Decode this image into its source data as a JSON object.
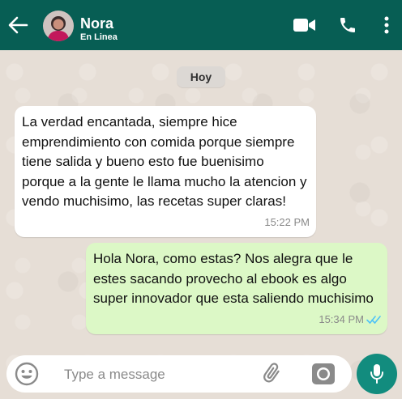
{
  "header": {
    "contact_name": "Nora",
    "status": "En Linea",
    "icons": {
      "back": "arrow-left-icon",
      "video": "video-camera-icon",
      "call": "phone-icon",
      "menu": "more-vert-icon"
    },
    "colors": {
      "bar": "#075e54"
    }
  },
  "chat": {
    "day_label": "Hoy",
    "messages": [
      {
        "direction": "incoming",
        "text": "La verdad encantada, siempre hice emprendimiento con comida porque siempre tiene salida y bueno esto fue buenisimo porque a la gente le llama mucho la atencion y vendo muchisimo, las recetas super claras!",
        "time": "15:22 PM"
      },
      {
        "direction": "outgoing",
        "text": "Hola Nora, como estas? Nos alegra que le estes sacando provecho al ebook es algo super innovador que esta saliendo muchisimo",
        "time": "15:34 PM",
        "status_icon": "double-check-icon"
      }
    ],
    "colors": {
      "incoming": "#ffffff",
      "outgoing": "#dcf8c6",
      "ticks": "#4fc3f7"
    }
  },
  "composer": {
    "placeholder": "Type a message",
    "icons": {
      "emoji": "emoji-icon",
      "attach": "paperclip-icon",
      "camera": "camera-icon",
      "mic": "microphone-icon"
    },
    "colors": {
      "mic_button": "#128c7e"
    }
  }
}
